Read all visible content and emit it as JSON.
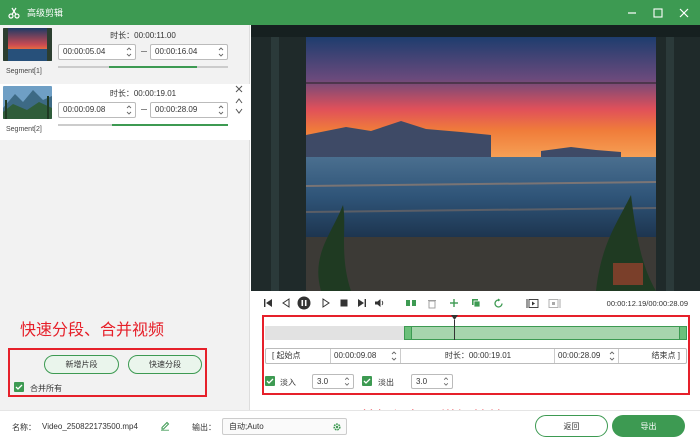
{
  "window": {
    "title": "高级剪辑",
    "logo_icon": "scissors-logo-icon",
    "controls": [
      "minimize-icon",
      "maximize-icon",
      "close-icon"
    ]
  },
  "segments": [
    {
      "label": "Segment[1]",
      "duration": "时长：00:00:11.00",
      "start": "00:00:05.04",
      "end": "00:00:16.04",
      "selected": false,
      "progress_fill": [
        0.3,
        0.82
      ]
    },
    {
      "label": "Segment[2]",
      "duration": "时长：00:00:19.01",
      "start": "00:00:09.08",
      "end": "00:00:28.09",
      "selected": true,
      "progress_fill": [
        0.32,
        1.0
      ]
    }
  ],
  "annotations": {
    "left": "快速分段、合并视频",
    "right": "剪辑视频、增加特效",
    "color": "#e6202a"
  },
  "left_actions": {
    "add_segment": "新增片段",
    "quick_split": "快速分段",
    "merge_all": "合并所有",
    "merge_all_checked": true
  },
  "player": {
    "time_readout": "00:00:12.19/00:00:28.09",
    "icons": [
      "skip-start-icon",
      "prev-frame-icon",
      "pause-icon",
      "next-frame-icon",
      "stop-icon",
      "skip-end-icon",
      "volume-icon",
      "split-icon",
      "delete-icon",
      "add-icon",
      "copy-icon",
      "reset-icon",
      "mark-in-icon",
      "mark-out-icon"
    ]
  },
  "timeline": {
    "selection": [
      0.33,
      1.0
    ],
    "playhead": 0.447
  },
  "trim": {
    "start_label": "[   起始点",
    "start_value": "00:00:09.08",
    "duration": "时长：00:00:19.01",
    "end_value": "00:00:28.09",
    "end_label": "结束点   ]"
  },
  "fade": {
    "in_label": "淡入",
    "in_value": "3.0",
    "in_checked": true,
    "out_label": "淡出",
    "out_value": "3.0",
    "out_checked": true
  },
  "bottom": {
    "name_label": "名称：",
    "name_value": "Video_250822173500.mp4",
    "output_label": "输出：",
    "output_value": "自动;Auto",
    "back_button": "返回",
    "export_button": "导出"
  },
  "colors": {
    "accent": "#3d9a52",
    "annotation": "#e6202a"
  }
}
